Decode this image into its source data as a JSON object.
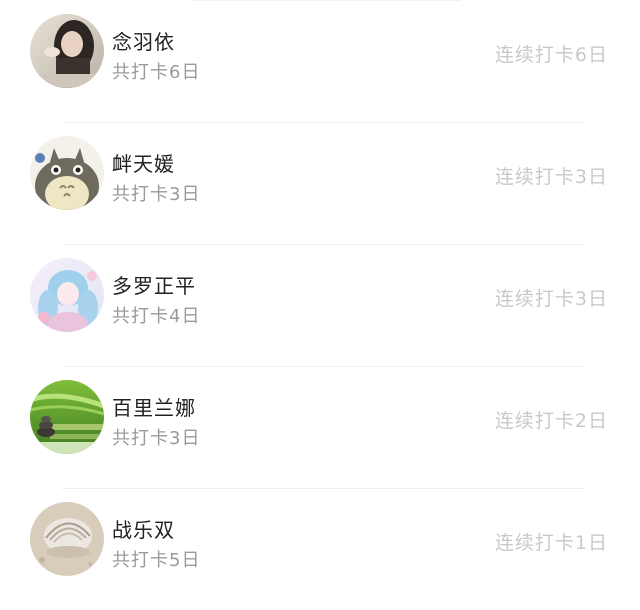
{
  "users": [
    {
      "name": "念羽依",
      "total": "共打卡6日",
      "streak": "连续打卡6日",
      "avatar_icon": "avatar-photo-girl-icon"
    },
    {
      "name": "衅天媛",
      "total": "共打卡3日",
      "streak": "连续打卡3日",
      "avatar_icon": "avatar-totoro-icon"
    },
    {
      "name": "多罗正平",
      "total": "共打卡4日",
      "streak": "连续打卡3日",
      "avatar_icon": "avatar-anime-girl-icon"
    },
    {
      "name": "百里兰娜",
      "total": "共打卡3日",
      "streak": "连续打卡2日",
      "avatar_icon": "avatar-bamboo-zen-icon"
    },
    {
      "name": "战乐双",
      "total": "共打卡5日",
      "streak": "连续打卡1日",
      "avatar_icon": "avatar-seashell-icon"
    }
  ]
}
